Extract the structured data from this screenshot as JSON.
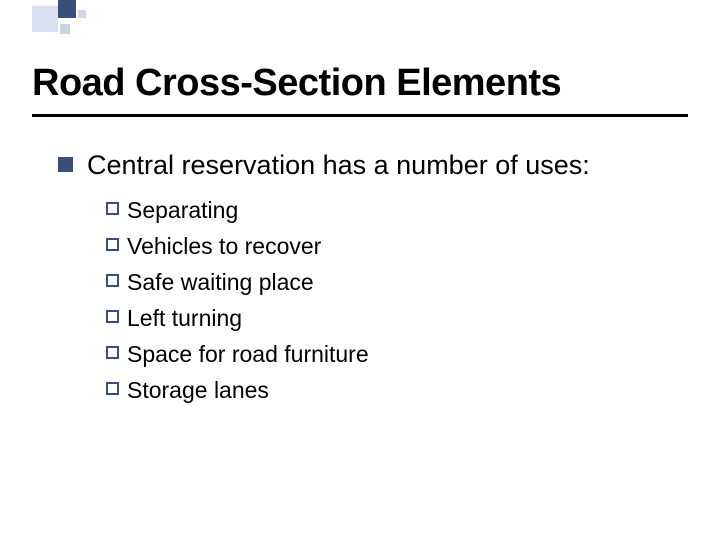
{
  "title": "Road Cross-Section Elements",
  "level1_text": "Central reservation has a number of uses:",
  "items": [
    {
      "label": "Separating"
    },
    {
      "label": "Vehicles to recover"
    },
    {
      "label": "Safe waiting place"
    },
    {
      "label": "Left turning"
    },
    {
      "label": "Space for road furniture"
    },
    {
      "label": "Storage lanes"
    }
  ],
  "colors": {
    "accent_dark": "#3a4e7a",
    "accent_light": "#d7dff0"
  }
}
